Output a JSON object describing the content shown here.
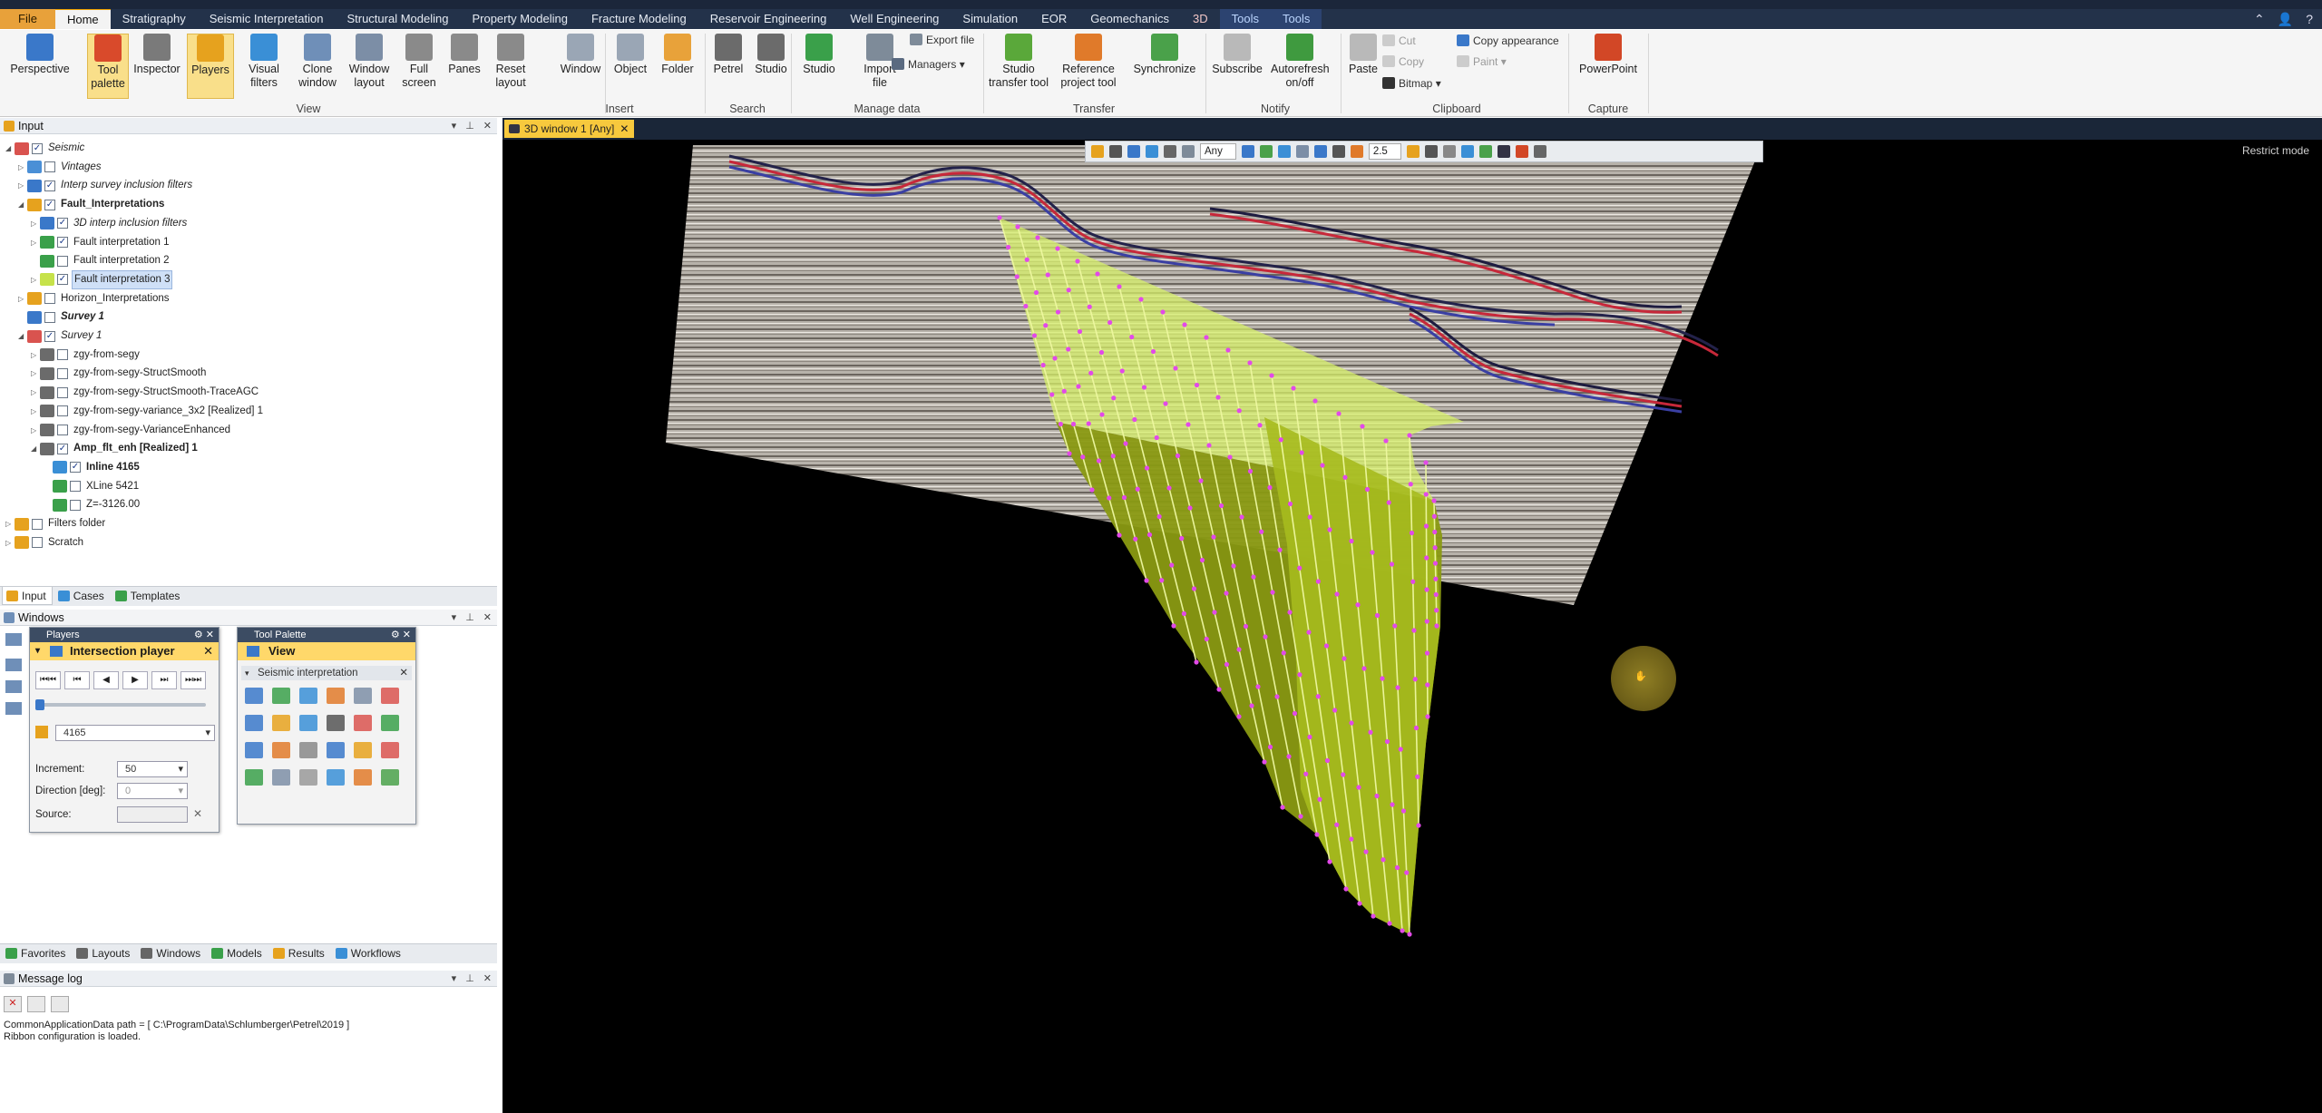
{
  "menubar": {
    "tabs": [
      {
        "label": "File"
      },
      {
        "label": "Home"
      },
      {
        "label": "Stratigraphy"
      },
      {
        "label": "Seismic Interpretation"
      },
      {
        "label": "Structural Modeling"
      },
      {
        "label": "Property Modeling"
      },
      {
        "label": "Fracture Modeling"
      },
      {
        "label": "Reservoir Engineering"
      },
      {
        "label": "Well Engineering"
      },
      {
        "label": "Simulation"
      },
      {
        "label": "EOR"
      },
      {
        "label": "Geomechanics"
      },
      {
        "label": "3D"
      },
      {
        "label": "Tools"
      },
      {
        "label": "Tools"
      }
    ]
  },
  "ribbon": {
    "buttons": [
      {
        "label": "Perspective",
        "color": "#3a78c9"
      },
      {
        "label": "Tool palette",
        "color": "#d94a2b"
      },
      {
        "label": "Inspector",
        "color": "#7a7a7a"
      },
      {
        "label": "Players",
        "color": "#e6a21e"
      },
      {
        "label": "Visual filters",
        "color": "#3a8fd6"
      },
      {
        "label": "Clone window",
        "color": "#6f8fb8"
      },
      {
        "label": "Window layout",
        "color": "#7c8ea6"
      },
      {
        "label": "Full screen",
        "color": "#8a8a8a"
      },
      {
        "label": "Panes",
        "color": "#8a8a8a"
      },
      {
        "label": "Reset layout",
        "color": "#8a8a8a"
      },
      {
        "label": "Window",
        "color": "#9aa6b5"
      },
      {
        "label": "Object",
        "color": "#9aa6b5"
      },
      {
        "label": "Folder",
        "color": "#e8a23a"
      },
      {
        "label": "Petrel",
        "color": "#6b6b6b"
      },
      {
        "label": "Studio",
        "color": "#6b6b6b"
      },
      {
        "label": "Studio",
        "color": "#3aa04a"
      },
      {
        "label": "Import file",
        "color": "#7e8b99"
      },
      {
        "label": "Studio transfer tool",
        "color": "#5aa83a"
      },
      {
        "label": "Reference project tool",
        "color": "#e07a2a"
      },
      {
        "label": "Synchronize",
        "color": "#4aa14a"
      },
      {
        "label": "Subscribe",
        "color": "#b9b9b9"
      },
      {
        "label": "Autorefresh on/off",
        "color": "#3f9a3f"
      },
      {
        "label": "Paste",
        "color": "#b9b9b9"
      },
      {
        "label": "PowerPoint",
        "color": "#d24726"
      }
    ],
    "small": {
      "export_file": "Export file",
      "managers": "Managers",
      "cut": "Cut",
      "copy": "Copy",
      "bitmap": "Bitmap",
      "copy_appearance": "Copy appearance",
      "paint": "Paint"
    },
    "groups": {
      "view": "View",
      "insert": "Insert",
      "search": "Search",
      "manage_data": "Manage data",
      "transfer": "Transfer",
      "notify": "Notify",
      "clipboard": "Clipboard",
      "capture": "Capture"
    }
  },
  "input_panel": {
    "title": "Input",
    "tree": [
      {
        "label": "Seismic",
        "style": "ital",
        "cb": "✓"
      },
      {
        "label": "Vintages",
        "style": "ital",
        "cb": ""
      },
      {
        "label": "Interp survey inclusion filters",
        "style": "ital",
        "cb": "✓"
      },
      {
        "label": "Fault_Interpretations",
        "style": "bold",
        "cb": "✓"
      },
      {
        "label": "3D interp inclusion filters",
        "style": "ital",
        "cb": "✓"
      },
      {
        "label": "Fault interpretation 1",
        "style": "",
        "cb": "✓"
      },
      {
        "label": "Fault interpretation 2",
        "style": "",
        "cb": ""
      },
      {
        "label": "Fault interpretation 3",
        "style": "hl",
        "cb": "✓"
      },
      {
        "label": "Horizon_Interpretations",
        "style": "",
        "cb": ""
      },
      {
        "label": "Survey 1",
        "style": "bold ital",
        "cb": ""
      },
      {
        "label": "Survey 1",
        "style": "ital",
        "cb": "✓"
      },
      {
        "label": "zgy-from-segy",
        "style": "",
        "cb": ""
      },
      {
        "label": "zgy-from-segy-StructSmooth",
        "style": "",
        "cb": ""
      },
      {
        "label": "zgy-from-segy-StructSmooth-TraceAGC",
        "style": "",
        "cb": ""
      },
      {
        "label": "zgy-from-segy-variance_3x2 [Realized] 1",
        "style": "",
        "cb": ""
      },
      {
        "label": "zgy-from-segy-VarianceEnhanced",
        "style": "",
        "cb": ""
      },
      {
        "label": "Amp_flt_enh [Realized] 1",
        "style": "bold",
        "cb": "✓"
      },
      {
        "label": "Inline 4165",
        "style": "bold",
        "cb": "✓"
      },
      {
        "label": "XLine 5421",
        "style": "",
        "cb": ""
      },
      {
        "label": "Z=-3126.00",
        "style": "",
        "cb": ""
      },
      {
        "label": "Filters folder",
        "style": "",
        "cb": ""
      },
      {
        "label": "Scratch",
        "style": "",
        "cb": ""
      }
    ]
  },
  "tabs_top": [
    {
      "label": "Input",
      "color": "#e6a21e"
    },
    {
      "label": "Cases",
      "color": "#3a8fd6"
    },
    {
      "label": "Templates",
      "color": "#3aa04a"
    }
  ],
  "windows_panel": {
    "title": "Windows"
  },
  "players": {
    "title": "Players",
    "sub": "Intersection player",
    "transport": [
      "⏮⏮",
      "⏮",
      "◀",
      "▶",
      "⏭",
      "⏭⏭"
    ],
    "slice_value": "4165",
    "increment_label": "Increment:",
    "increment_value": "50",
    "direction_label": "Direction [deg]:",
    "direction_value": "0",
    "source_label": "Source:"
  },
  "tool_palette": {
    "title": "Tool Palette",
    "sub": "View",
    "section": "Seismic interpretation"
  },
  "tabs_bottom": [
    {
      "label": "Favorites",
      "color": "#3aa04a"
    },
    {
      "label": "Layouts",
      "color": "#666"
    },
    {
      "label": "Windows",
      "color": "#666"
    },
    {
      "label": "Models",
      "color": "#3aa04a"
    },
    {
      "label": "Results",
      "color": "#e6a21e"
    },
    {
      "label": "Workflows",
      "color": "#3a8fd6"
    }
  ],
  "message_log": {
    "title": "Message log",
    "lines": [
      "CommonApplicationData path = [ C:\\ProgramData\\Schlumberger\\Petrel\\2019 ]",
      "Ribbon configuration is loaded."
    ]
  },
  "view3d": {
    "tab": "3D window 1 [Any]",
    "mode_text": "Restrict mode",
    "toolbar_domain": "Any",
    "toolbar_zoom": "2.5"
  },
  "colors": {
    "menubar": "#23324a",
    "accent": "#f7c93d",
    "fault": "#c6e24a",
    "seismic_bg": "#b9b4ad"
  }
}
